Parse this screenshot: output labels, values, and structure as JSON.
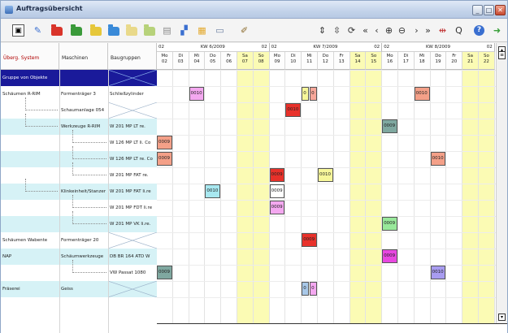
{
  "window": {
    "title": "Auftragsübersicht",
    "minimize": "_",
    "maximize": "□",
    "close": "✕"
  },
  "toolbar": {
    "zoom_label": "Q",
    "help_label": "?",
    "nav_first": "«",
    "nav_prev": "‹",
    "nav_next": "›",
    "nav_last": "»"
  },
  "left_headers": {
    "system": "Überg. System",
    "machines": "Maschinen",
    "groups": "Baugruppen"
  },
  "rows": [
    {
      "system": "Gruppe von Objekte",
      "machine": "",
      "group": "",
      "style": "group",
      "xmark": true
    },
    {
      "system": "Schäumen R-RIM",
      "machine": "Formenträger 3",
      "group": "Schließzylinder",
      "style": "",
      "xmark": false
    },
    {
      "system": "",
      "machine": "Schaumanlage 054",
      "group": "",
      "style": "",
      "xmark": true,
      "tree": 1
    },
    {
      "system": "",
      "machine": "Werkzeuge R-RIM",
      "group": "W 201 MP LT re.",
      "style": "cyan",
      "xmark": false,
      "tree": 1
    },
    {
      "system": "",
      "machine": "",
      "group": "W 126 MP LT li. Co",
      "style": "",
      "xmark": false,
      "tree": 2
    },
    {
      "system": "",
      "machine": "",
      "group": "W 126 MP LT re. Co",
      "style": "cyan",
      "xmark": false,
      "tree": 2
    },
    {
      "system": "",
      "machine": "",
      "group": "W 201 MP FAT re.",
      "style": "",
      "xmark": false,
      "tree": 2
    },
    {
      "system": "",
      "machine": "Klinkeinheit/Stanzer",
      "group": "W 201 MP FAT li.re",
      "style": "cyan",
      "xmark": false,
      "tree": 1
    },
    {
      "system": "",
      "machine": "",
      "group": "W 201 MP FDT li.re",
      "style": "",
      "xmark": false,
      "tree": 2
    },
    {
      "system": "",
      "machine": "",
      "group": "W 201 MP VK li.re.",
      "style": "cyan",
      "xmark": false,
      "tree": 2
    },
    {
      "system": "Schäumen Wabente",
      "machine": "Formenträger 20",
      "group": "",
      "style": "",
      "xmark": true
    },
    {
      "system": "NAP",
      "machine": "Schäumwerkzeuge",
      "group": "DB BR 164 ATD W",
      "style": "cyan",
      "xmark": false
    },
    {
      "system": "",
      "machine": "",
      "group": "VW Passat 1080",
      "style": "",
      "xmark": false,
      "tree": 2
    },
    {
      "system": "Fräserei",
      "machine": "Geiss",
      "group": "",
      "style": "cyan",
      "xmark": true
    }
  ],
  "weeks": [
    {
      "left": "02",
      "mid": "KW 6/2009",
      "right": "02"
    },
    {
      "left": "02",
      "mid": "KW 7/2009",
      "right": "02"
    },
    {
      "left": "02",
      "mid": "KW 8/2009",
      "right": "02"
    }
  ],
  "days": [
    {
      "dow": "Mo",
      "num": "02",
      "weekend": false
    },
    {
      "dow": "Di",
      "num": "03",
      "weekend": false
    },
    {
      "dow": "Mi",
      "num": "04",
      "weekend": false
    },
    {
      "dow": "Do",
      "num": "05",
      "weekend": false
    },
    {
      "dow": "Fr",
      "num": "06",
      "weekend": false
    },
    {
      "dow": "Sa",
      "num": "07",
      "weekend": true
    },
    {
      "dow": "So",
      "num": "08",
      "weekend": true
    },
    {
      "dow": "Mo",
      "num": "09",
      "weekend": false
    },
    {
      "dow": "Di",
      "num": "10",
      "weekend": false
    },
    {
      "dow": "Mi",
      "num": "11",
      "weekend": false
    },
    {
      "dow": "Do",
      "num": "12",
      "weekend": false
    },
    {
      "dow": "Fr",
      "num": "13",
      "weekend": false
    },
    {
      "dow": "Sa",
      "num": "14",
      "weekend": true
    },
    {
      "dow": "So",
      "num": "15",
      "weekend": true
    },
    {
      "dow": "Mo",
      "num": "16",
      "weekend": false
    },
    {
      "dow": "Di",
      "num": "17",
      "weekend": false
    },
    {
      "dow": "Mi",
      "num": "18",
      "weekend": false
    },
    {
      "dow": "Do",
      "num": "19",
      "weekend": false
    },
    {
      "dow": "Fr",
      "num": "20",
      "weekend": false
    },
    {
      "dow": "Sa",
      "num": "21",
      "weekend": true
    },
    {
      "dow": "So",
      "num": "22",
      "weekend": true
    }
  ],
  "tasks": [
    {
      "row": 1,
      "day": "04",
      "label": "0010",
      "color": "#f4a8f0"
    },
    {
      "row": 1,
      "day": "11",
      "label": "0",
      "color": "#f7f79a"
    },
    {
      "row": 1,
      "day": "11",
      "label": "0",
      "color": "#f7a79a"
    },
    {
      "row": 1,
      "day": "18",
      "label": "0010",
      "color": "#f4a088"
    },
    {
      "row": 2,
      "day": "10",
      "label": "0010",
      "color": "#e8312a"
    },
    {
      "row": 3,
      "day": "16",
      "label": "0009",
      "color": "#7fa8a0"
    },
    {
      "row": 4,
      "day": "02",
      "label": "0009",
      "color": "#f4a088"
    },
    {
      "row": 5,
      "day": "02",
      "label": "0009",
      "color": "#f4a088"
    },
    {
      "row": 5,
      "day": "19",
      "label": "0010",
      "color": "#f4a088"
    },
    {
      "row": 6,
      "day": "09",
      "label": "0009",
      "color": "#e8312a"
    },
    {
      "row": 6,
      "day": "12",
      "label": "0010",
      "color": "#f7f79a"
    },
    {
      "row": 7,
      "day": "05",
      "label": "0010",
      "color": "#a8e8f0"
    },
    {
      "row": 7,
      "day": "09",
      "label": "0009",
      "color": "#ffffff"
    },
    {
      "row": 8,
      "day": "09",
      "label": "0009",
      "color": "#f4a8f0"
    },
    {
      "row": 9,
      "day": "16",
      "label": "0009",
      "color": "#98e89a"
    },
    {
      "row": 10,
      "day": "11",
      "label": "0009",
      "color": "#e8312a"
    },
    {
      "row": 11,
      "day": "16",
      "label": "0009",
      "color": "#e848e0"
    },
    {
      "row": 12,
      "day": "02",
      "label": "0009",
      "color": "#7fa8a0"
    },
    {
      "row": 12,
      "day": "19",
      "label": "0010",
      "color": "#a89cf0"
    },
    {
      "row": 13,
      "day": "11",
      "label": "0",
      "color": "#a8c8e8"
    },
    {
      "row": 13,
      "day": "11",
      "label": "0",
      "color": "#f4a8f0"
    }
  ]
}
